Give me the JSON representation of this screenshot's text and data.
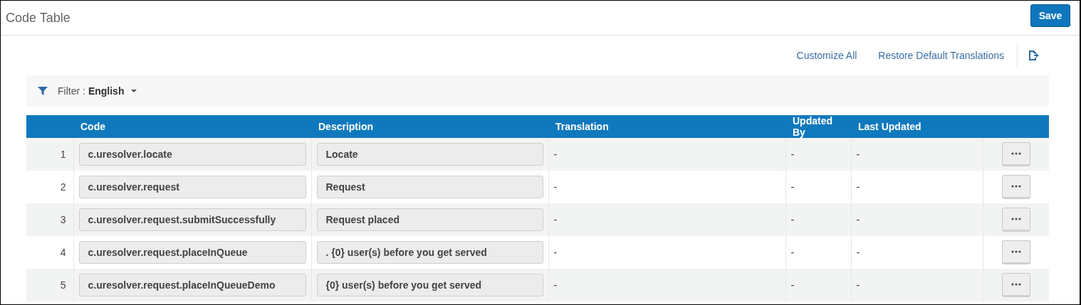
{
  "header": {
    "title": "Code Table",
    "save_button": "Save"
  },
  "toolbar": {
    "links": [
      "Customize All",
      "Restore Default Translations"
    ]
  },
  "filter": {
    "label": "Filter :",
    "value": "English"
  },
  "table": {
    "columns": [
      "",
      "Code",
      "Description",
      "Translation",
      "Updated By",
      "Last Updated",
      ""
    ],
    "rows": [
      {
        "number": "1",
        "code": "c.uresolver.locate",
        "description": "Locate",
        "translation": "-",
        "updated_by": "-",
        "last_updated": "-"
      },
      {
        "number": "2",
        "code": "c.uresolver.request",
        "description": "Request",
        "translation": "-",
        "updated_by": "-",
        "last_updated": "-"
      },
      {
        "number": "3",
        "code": "c.uresolver.request.submitSuccessfully",
        "description": "Request placed",
        "translation": "-",
        "updated_by": "-",
        "last_updated": "-"
      },
      {
        "number": "4",
        "code": "c.uresolver.request.placeInQueue",
        "description": ". {0} user(s) before you get served",
        "translation": "-",
        "updated_by": "-",
        "last_updated": "-"
      },
      {
        "number": "5",
        "code": "c.uresolver.request.placeInQueueDemo",
        "description": "{0} user(s) before you get served",
        "translation": "-",
        "updated_by": "-",
        "last_updated": "-"
      }
    ]
  }
}
